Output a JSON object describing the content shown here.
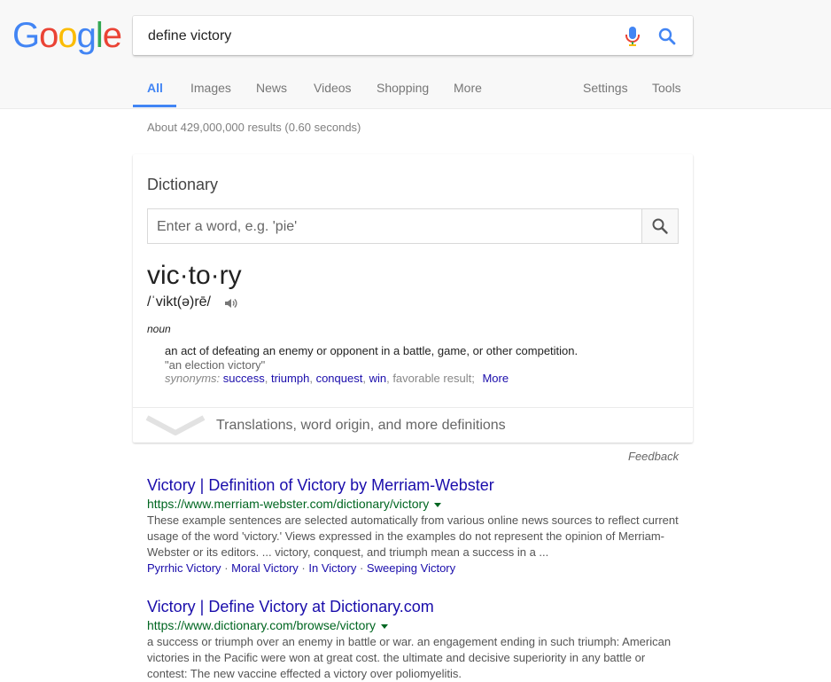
{
  "logo": {
    "text": "Google",
    "colors": [
      "#4285f4",
      "#ea4335",
      "#fbbc05",
      "#4285f4",
      "#34a853",
      "#ea4335"
    ]
  },
  "search": {
    "query": "define victory"
  },
  "tabs": [
    {
      "label": "All",
      "active": true
    },
    {
      "label": "Images"
    },
    {
      "label": "News"
    },
    {
      "label": "Videos"
    },
    {
      "label": "Shopping"
    },
    {
      "label": "More"
    }
  ],
  "tools": {
    "settings": "Settings",
    "tools": "Tools"
  },
  "stats": "About 429,000,000 results (0.60 seconds)",
  "dictionary": {
    "title": "Dictionary",
    "placeholder": "Enter a word, e.g. 'pie'",
    "word": "vic·to·ry",
    "phonetic": "/ˈvikt(ə)rē/",
    "part_of_speech": "noun",
    "definition": "an act of defeating an enemy or opponent in a battle, game, or other competition.",
    "example": "\"an election victory\"",
    "synonyms_label": "synonyms:",
    "synonyms": [
      {
        "text": "success",
        "link": true
      },
      {
        "text": "triumph",
        "link": true
      },
      {
        "text": "conquest",
        "link": true
      },
      {
        "text": "win",
        "link": true
      },
      {
        "text": "favorable result",
        "link": false
      }
    ],
    "more_label": "More",
    "expand_label": "Translations, word origin, and more definitions"
  },
  "feedback": "Feedback",
  "results": [
    {
      "title": "Victory | Definition of Victory by Merriam-Webster",
      "url": "https://www.merriam-webster.com/dictionary/victory",
      "snippet_lines": [
        "These example sentences are selected automatically from various online news sources to reflect current",
        "usage of the word 'victory.' Views expressed in the examples do not represent the opinion of Merriam-",
        "Webster or its editors. ... victory, conquest, and triumph mean a success in a ..."
      ],
      "sitelinks": [
        "Pyrrhic Victory",
        "Moral Victory",
        "In Victory",
        "Sweeping Victory"
      ]
    },
    {
      "title": "Victory | Define Victory at Dictionary.com",
      "url": "https://www.dictionary.com/browse/victory",
      "snippet_lines": [
        "a success or triumph over an enemy in battle or war. an engagement ending in such triumph: American",
        "victories in the Pacific were won at great cost. the ultimate and decisive superiority in any battle or",
        "contest: The new vaccine effected a victory over poliomyelitis."
      ]
    }
  ]
}
